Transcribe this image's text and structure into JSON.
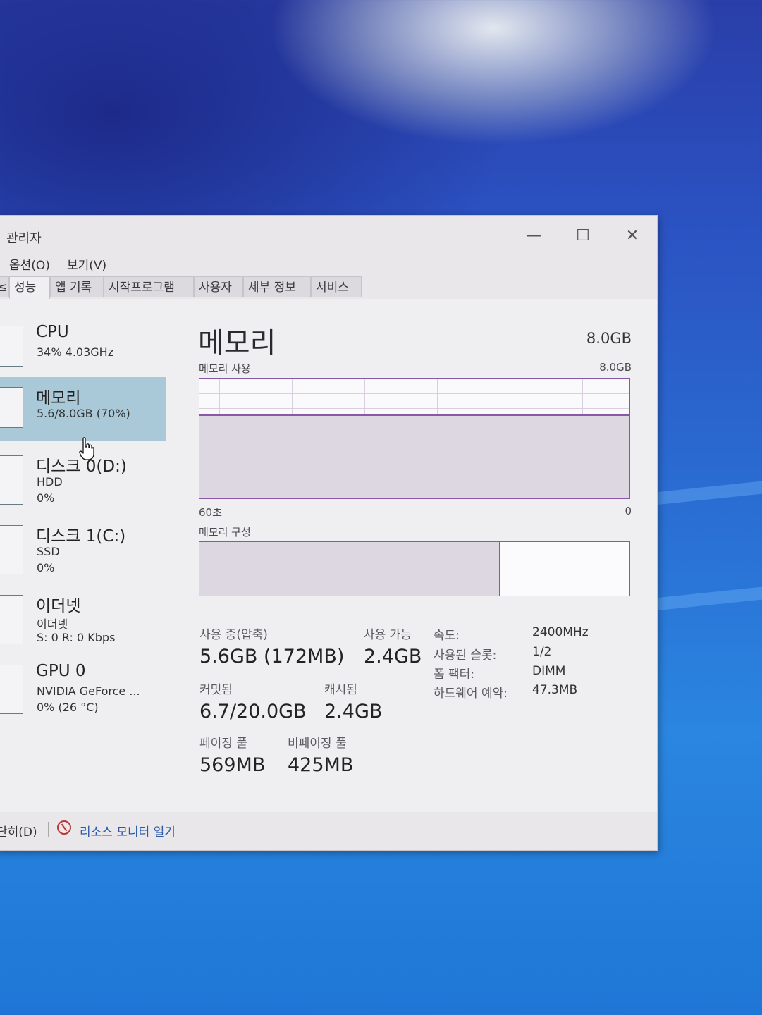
{
  "window": {
    "title": "관리자",
    "buttons": {
      "minimize": "—",
      "maximize": "☐",
      "close": "✕"
    }
  },
  "menu": [
    "옵션(O)",
    "보기(V)"
  ],
  "tabs": {
    "cut": "≤",
    "items": [
      "성능",
      "앱 기록",
      "시작프로그램",
      "사용자",
      "세부 정보",
      "서비스"
    ],
    "active": 0
  },
  "sidebar": [
    {
      "name": "CPU",
      "line1": "34% 4.03GHz",
      "line2": ""
    },
    {
      "name": "메모리",
      "line1": "5.6/8.0GB (70%)",
      "line2": ""
    },
    {
      "name": "디스크 0(D:)",
      "line1": "HDD",
      "line2": "0%"
    },
    {
      "name": "디스크 1(C:)",
      "line1": "SSD",
      "line2": "0%"
    },
    {
      "name": "이더넷",
      "line1": "이더넷",
      "line2": "S: 0 R: 0 Kbps"
    },
    {
      "name": "GPU 0",
      "line1": "NVIDIA GeForce ...",
      "line2": "0% (26 °C)"
    }
  ],
  "main": {
    "title": "메모리",
    "total": "8.0GB",
    "usage_label": "메모리 사용",
    "usage_max": "8.0GB",
    "time_left": "60초",
    "time_right": "0",
    "composition_label": "메모리 구성",
    "usage_level": 0.7,
    "composition_in_use_fraction": 0.7
  },
  "stats": {
    "in_use_label": "사용 중(압축)",
    "in_use_value": "5.6GB (172MB)",
    "available_label": "사용 가능",
    "available_value": "2.4GB",
    "committed_label": "커밋됨",
    "committed_value": "6.7/20.0GB",
    "cached_label": "캐시됨",
    "cached_value": "2.4GB",
    "paged_label": "페이징 풀",
    "paged_value": "569MB",
    "nonpaged_label": "비페이징 풀",
    "nonpaged_value": "425MB"
  },
  "details": [
    {
      "key": "속도:",
      "value": "2400MHz"
    },
    {
      "key": "사용된 슬롯:",
      "value": "1/2"
    },
    {
      "key": "폼 팩터:",
      "value": "DIMM"
    },
    {
      "key": "하드웨어 예약:",
      "value": "47.3MB"
    }
  ],
  "footer": {
    "fewer_details": "단히(D)",
    "resource_monitor": "리소스 모니터 열기"
  },
  "colors": {
    "accent": "#8b57a8",
    "selected": "#a9c9d8"
  }
}
